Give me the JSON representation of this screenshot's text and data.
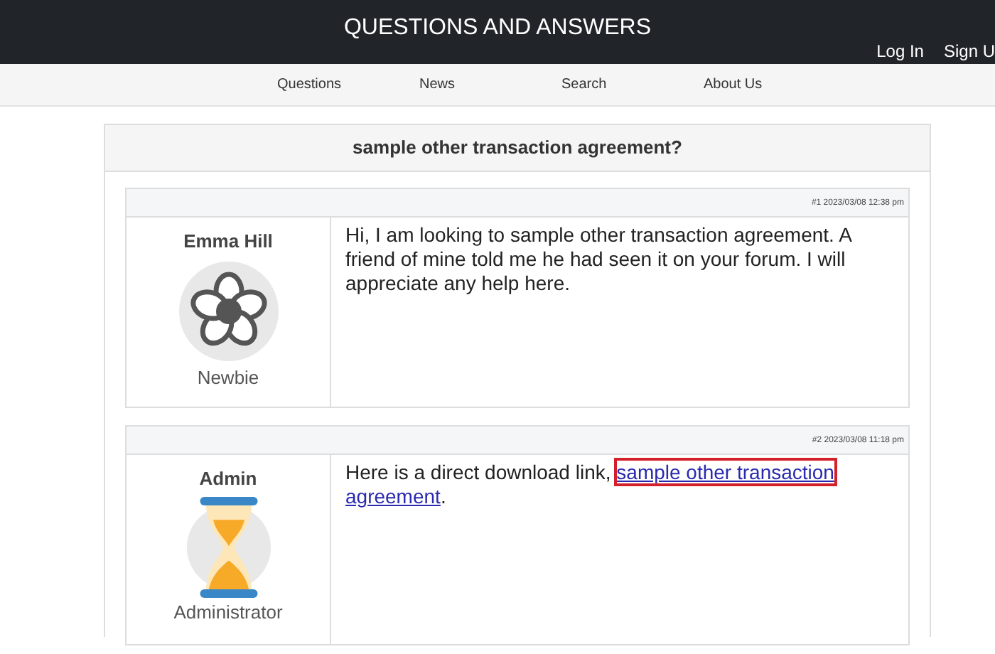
{
  "header": {
    "title": "QUESTIONS AND ANSWERS",
    "account_links": [
      "Log In",
      "Sign U"
    ]
  },
  "nav": [
    "Questions",
    "News",
    "Search",
    "About Us"
  ],
  "thread": {
    "title": "sample other transaction agreement?",
    "posts": [
      {
        "meta": "#1 2023/03/08 12:38 pm",
        "author": "Emma Hill",
        "avatar": {
          "kind": "flower"
        },
        "rank": "Newbie",
        "body": [
          {
            "kind": "text",
            "text": "Hi, I am looking to sample other transaction agreement. A friend of mine told me he had seen it on your forum. I will appreciate any help here."
          }
        ]
      },
      {
        "meta": "#2 2023/03/08 11:18 pm",
        "author": "Admin",
        "avatar": {
          "kind": "hourglass"
        },
        "rank": "Administrator",
        "body": [
          {
            "kind": "text",
            "text": "Here is a direct download link, "
          },
          {
            "kind": "link",
            "text": "sample other transaction",
            "highlighted": true
          },
          {
            "kind": "link",
            "text": "agreement",
            "highlighted": false
          },
          {
            "kind": "text",
            "text": "."
          }
        ]
      }
    ]
  }
}
